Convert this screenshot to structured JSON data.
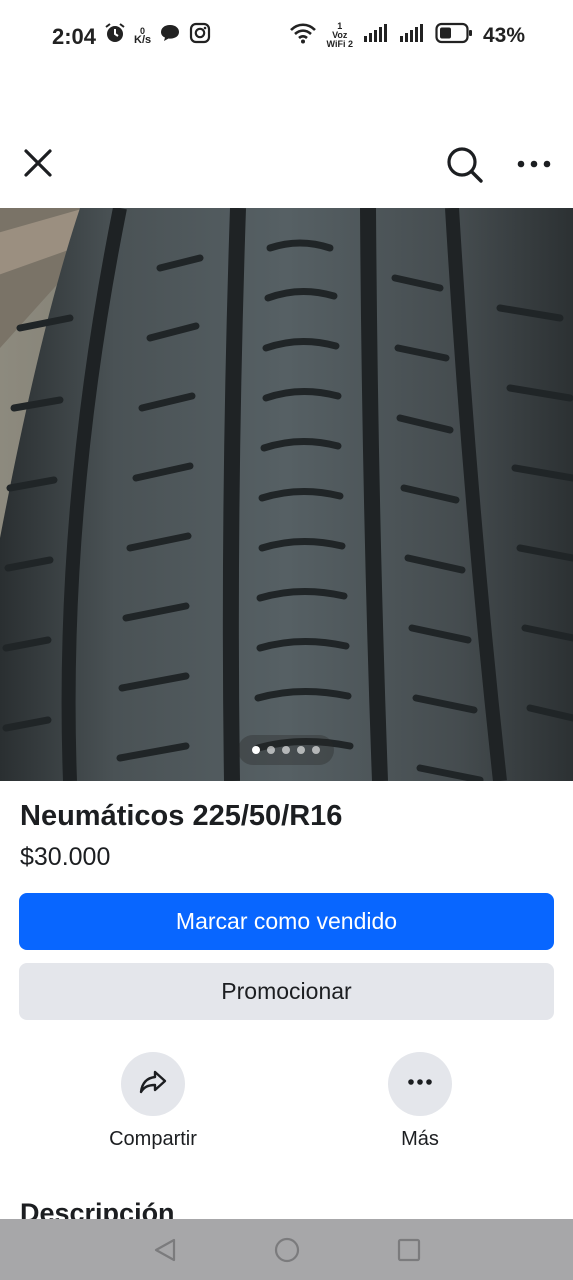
{
  "status_bar": {
    "time": "2:04",
    "speed_top": "0",
    "speed_unit": "K/s",
    "sim_label_top": "1",
    "sim_label_voz": "Voz",
    "sim_label_wifi": "WiFi 2",
    "battery": "43%"
  },
  "listing": {
    "title": "Neumáticos 225/50/R16",
    "price": "$30.000",
    "image_count": 5,
    "active_image": 1
  },
  "buttons": {
    "mark_sold": "Marcar como vendido",
    "promote": "Promocionar"
  },
  "actions": {
    "share": "Compartir",
    "more": "Más"
  },
  "section": {
    "description_heading": "Descripción"
  },
  "colors": {
    "primary": "#0866ff",
    "secondary_bg": "#e4e6eb"
  }
}
